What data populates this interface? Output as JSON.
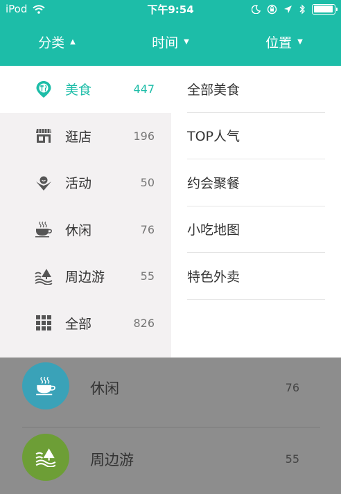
{
  "status_bar": {
    "carrier": "iPod",
    "time": "下午9:54",
    "battery_level": 0.95
  },
  "tabs": [
    {
      "label": "分类",
      "caret": "▲"
    },
    {
      "label": "时间",
      "caret": "▼"
    },
    {
      "label": "位置",
      "caret": "▼"
    }
  ],
  "categories": [
    {
      "label": "美食",
      "count": "447",
      "icon": "food-pin-icon",
      "active": true
    },
    {
      "label": "逛店",
      "count": "196",
      "icon": "shop-icon"
    },
    {
      "label": "活动",
      "count": "50",
      "icon": "activity-icon"
    },
    {
      "label": "休闲",
      "count": "76",
      "icon": "coffee-cup-icon"
    },
    {
      "label": "周边游",
      "count": "55",
      "icon": "landscape-icon"
    },
    {
      "label": "全部",
      "count": "826",
      "icon": "grid-icon"
    }
  ],
  "subcategories": [
    {
      "label": "全部美食"
    },
    {
      "label": "TOP人气"
    },
    {
      "label": "约会聚餐"
    },
    {
      "label": "小吃地图"
    },
    {
      "label": "特色外卖"
    }
  ],
  "background_list": [
    {
      "label": "休闲",
      "count": "76",
      "icon": "coffee-cup-icon",
      "color": "#3aa2b8"
    },
    {
      "label": "周边游",
      "count": "55",
      "icon": "landscape-icon",
      "color": "#6d9e36"
    }
  ],
  "colors": {
    "accent": "#1dbda8",
    "panel_bg": "#f3f1f2",
    "overlay": "#8d8d8d"
  }
}
